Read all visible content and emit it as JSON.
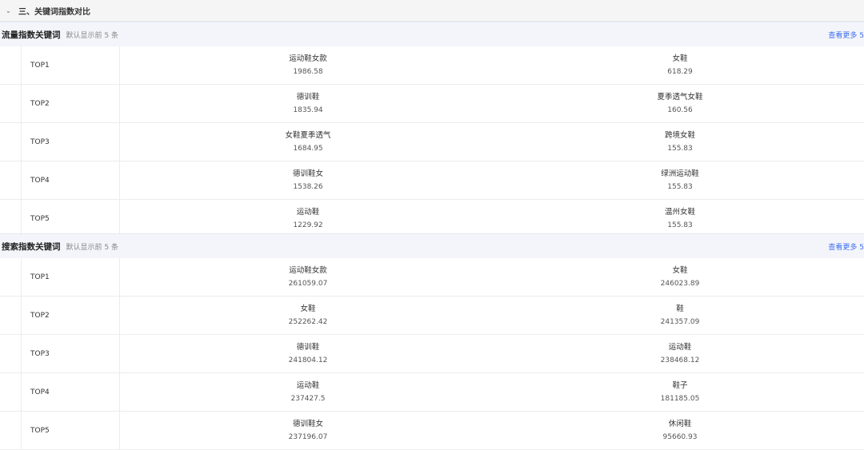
{
  "section": {
    "title": "三、关键词指数对比",
    "chevron_icon": "chevron-down-icon"
  },
  "panels": [
    {
      "title": "流量指数关键词",
      "hint": "默认显示前 5 条",
      "more": "查看更多 5",
      "rows": [
        {
          "rank": "TOP1",
          "k1": "运动鞋女款",
          "v1": "1986.58",
          "k2": "女鞋",
          "v2": "618.29"
        },
        {
          "rank": "TOP2",
          "k1": "德训鞋",
          "v1": "1835.94",
          "k2": "夏季透气女鞋",
          "v2": "160.56"
        },
        {
          "rank": "TOP3",
          "k1": "女鞋夏季透气",
          "v1": "1684.95",
          "k2": "跨境女鞋",
          "v2": "155.83"
        },
        {
          "rank": "TOP4",
          "k1": "德训鞋女",
          "v1": "1538.26",
          "k2": "绿洲运动鞋",
          "v2": "155.83"
        },
        {
          "rank": "TOP5",
          "k1": "运动鞋",
          "v1": "1229.92",
          "k2": "温州女鞋",
          "v2": "155.83"
        }
      ]
    },
    {
      "title": "搜索指数关键词",
      "hint": "默认显示前 5 条",
      "more": "查看更多 5",
      "rows": [
        {
          "rank": "TOP1",
          "k1": "运动鞋女款",
          "v1": "261059.07",
          "k2": "女鞋",
          "v2": "246023.89"
        },
        {
          "rank": "TOP2",
          "k1": "女鞋",
          "v1": "252262.42",
          "k2": "鞋",
          "v2": "241357.09"
        },
        {
          "rank": "TOP3",
          "k1": "德训鞋",
          "v1": "241804.12",
          "k2": "运动鞋",
          "v2": "238468.12"
        },
        {
          "rank": "TOP4",
          "k1": "运动鞋",
          "v1": "237427.5",
          "k2": "鞋子",
          "v2": "181185.05"
        },
        {
          "rank": "TOP5",
          "k1": "德训鞋女",
          "v1": "237196.07",
          "k2": "休闲鞋",
          "v2": "95660.93"
        }
      ]
    }
  ]
}
